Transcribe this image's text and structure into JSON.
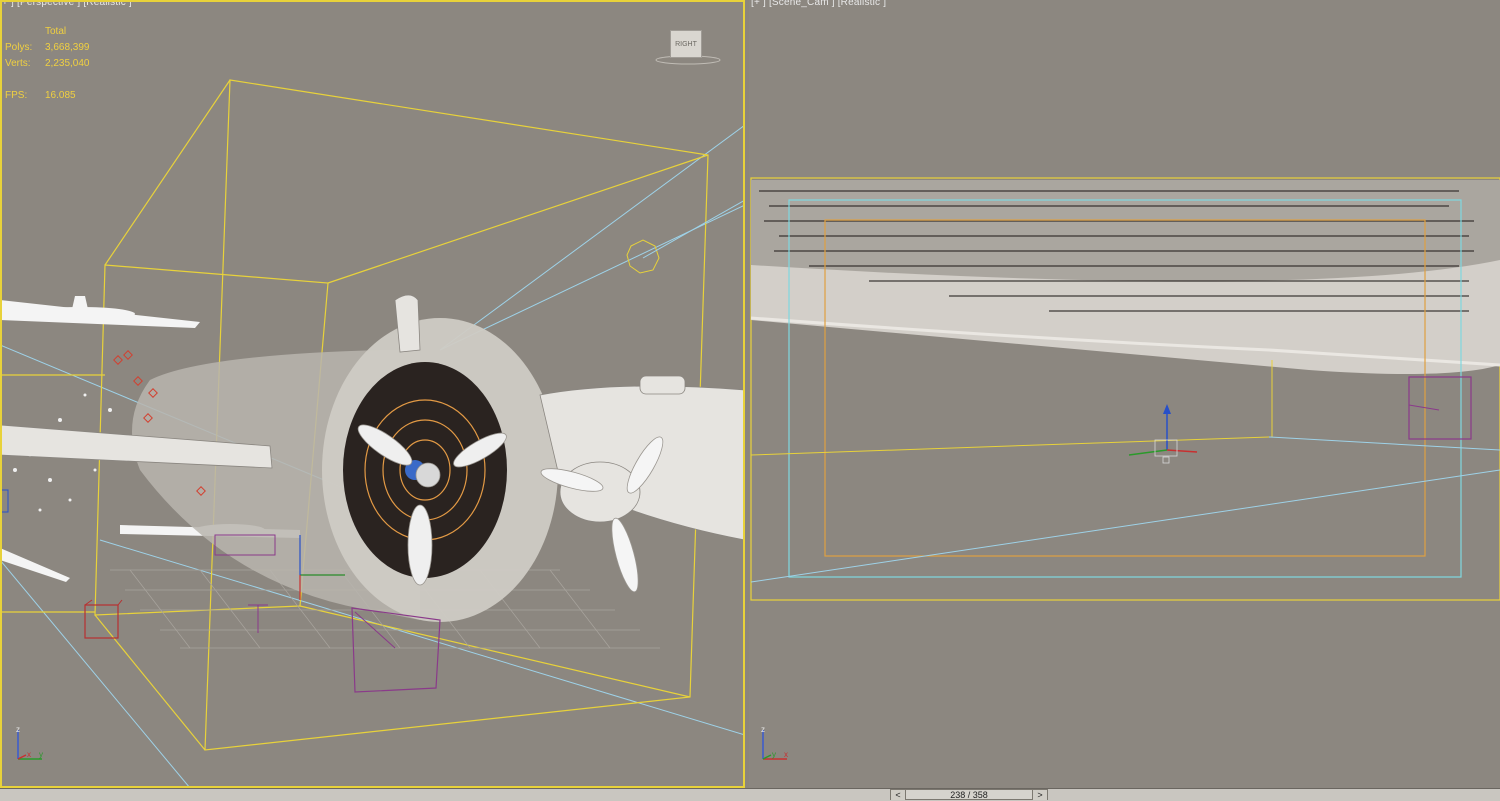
{
  "viewports": {
    "left": {
      "label": "+ ] [Perspective ] [Realistic ]"
    },
    "right": {
      "label": "[+ ] [Scene_Cam ] [Realistic ]"
    }
  },
  "stats": {
    "total_label": "Total",
    "polys_label": "Polys:",
    "polys_value": "3,668,399",
    "verts_label": "Verts:",
    "verts_value": "2,235,040",
    "fps_label": "FPS:",
    "fps_value": "16.085"
  },
  "viewcube": {
    "face": "RIGHT"
  },
  "axis": {
    "x": "x",
    "y": "y",
    "z": "z"
  },
  "timeslider": {
    "frame": "238 / 358",
    "prev": "<",
    "next": ">"
  },
  "colors": {
    "selection": "#e8d23a",
    "camera_line": "#9ed2e8",
    "safe_frame_outer": "#7fd8e0",
    "safe_frame_inner": "#e0a040"
  }
}
